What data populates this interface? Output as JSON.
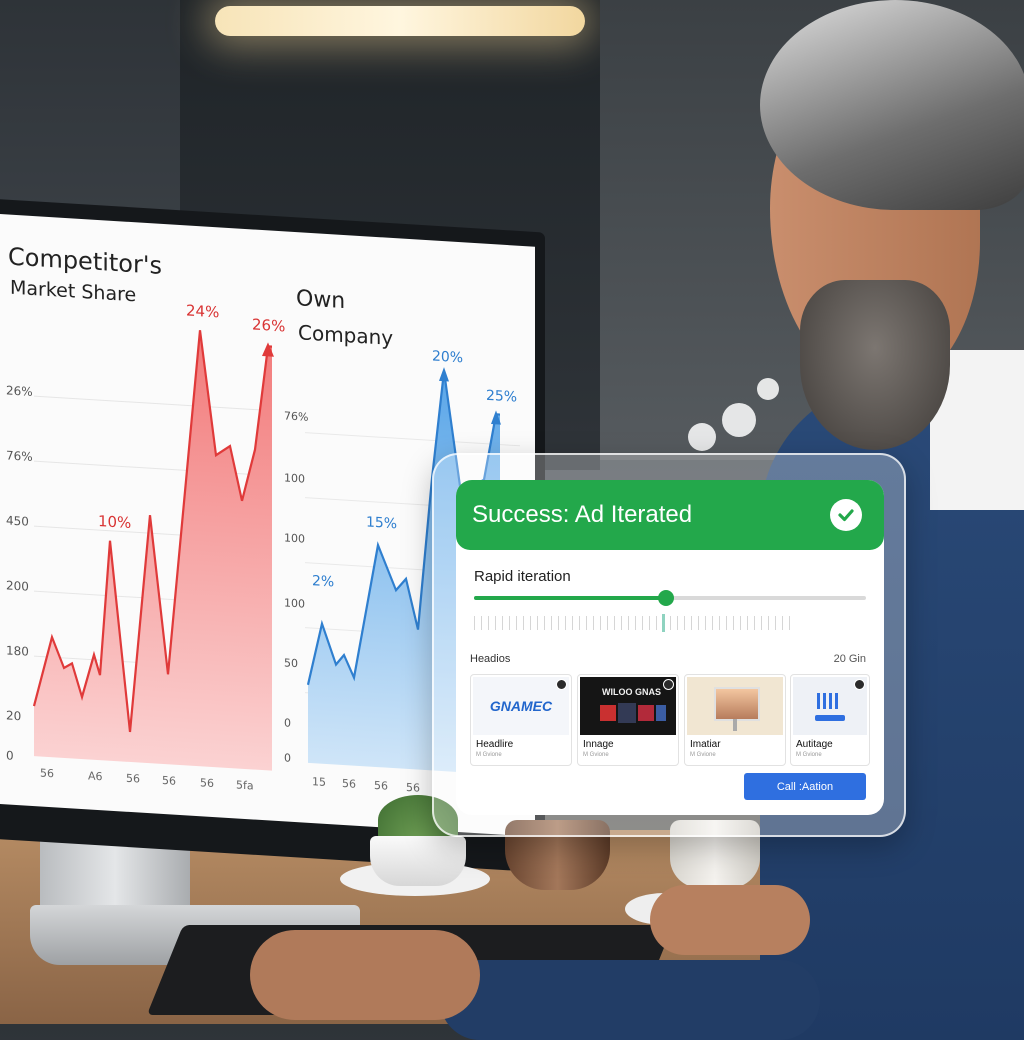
{
  "monitor": {
    "left_chart_title_line1": "Competitor's",
    "left_chart_title_line2": "Market Share",
    "right_chart_title_line1": "Own",
    "right_chart_title_line2": "Company"
  },
  "chart_data": [
    {
      "type": "area",
      "title": "Competitor's Market Share",
      "y_tick_labels": [
        "0",
        "20",
        "180",
        "200",
        "450",
        "76%",
        "26%"
      ],
      "x_tick_labels": [
        "56",
        "A6",
        "56",
        "56",
        "56",
        "5fa"
      ],
      "peak_labels": [
        "10%",
        "24%",
        "26%"
      ],
      "color": "#e84848"
    },
    {
      "type": "area",
      "title": "Own Company",
      "y_tick_labels": [
        "0",
        "0",
        "50",
        "100",
        "100",
        "100",
        "76%"
      ],
      "x_tick_labels": [
        "15",
        "56",
        "56",
        "56"
      ],
      "peak_labels": [
        "2%",
        "15%",
        "20%",
        "25%"
      ],
      "color": "#3b8fdc"
    }
  ],
  "card": {
    "status": "Success: Ad Iterated",
    "slider_label": "Rapid iteration",
    "slider_value": 0.49,
    "section_label": "Headios",
    "section_count": "20 Gin",
    "tiles": [
      {
        "title": "Headlire",
        "sub": "M Gvione",
        "thumb_text": "GNAMEC"
      },
      {
        "title": "Innage",
        "sub": "M Gvione",
        "thumb_text": "WILOO GNAS"
      },
      {
        "title": "Imatiar",
        "sub": "M Gvione",
        "thumb_text": ""
      },
      {
        "title": "Autitage",
        "sub": "M Gvione",
        "thumb_text": ""
      }
    ],
    "cta_label": "Call :Aation"
  },
  "colors": {
    "success": "#23a84b",
    "cta": "#2f6fe0",
    "competitor": "#e84848",
    "own": "#3b8fdc"
  }
}
